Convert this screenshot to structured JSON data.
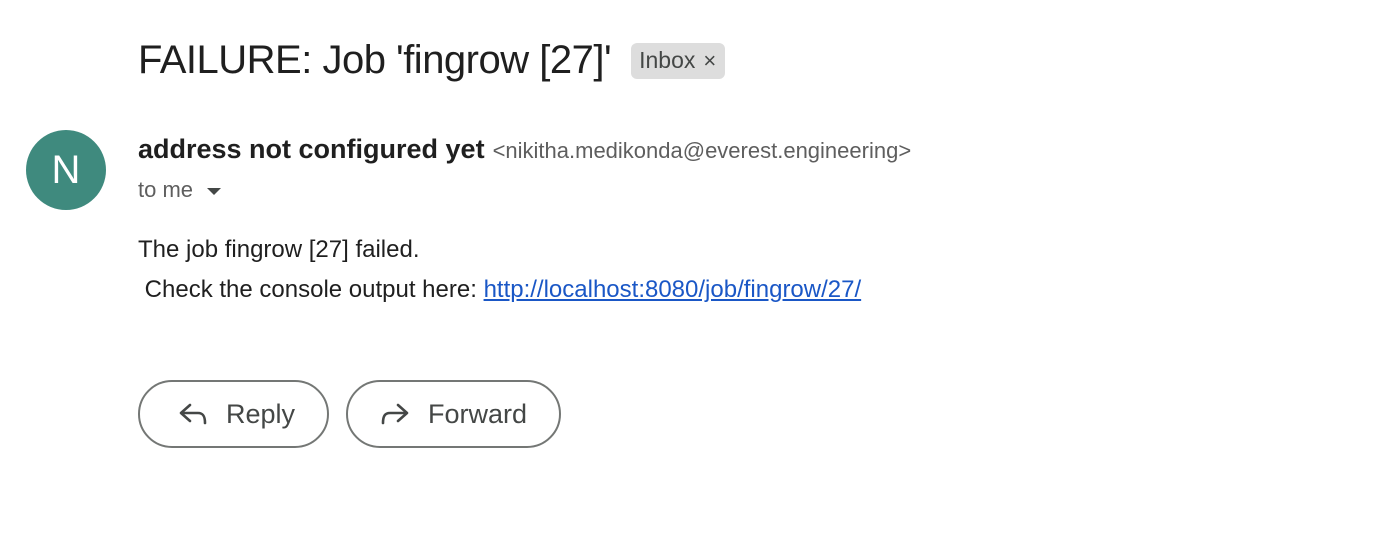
{
  "email": {
    "subject": "FAILURE: Job 'fingrow [27]'",
    "label": "Inbox",
    "label_remove_glyph": "×",
    "sender": {
      "initial": "N",
      "avatar_color": "#3f8a7e",
      "name": "address not configured yet",
      "email": "<nikitha.medikonda@everest.engineering>"
    },
    "recipient_summary": "to me",
    "body": {
      "line1": "The job fingrow [27] failed.",
      "line2_prefix": " Check the console output here: ",
      "link_text": "http://localhost:8080/job/fingrow/27/"
    },
    "actions": {
      "reply_label": "Reply",
      "forward_label": "Forward"
    }
  },
  "icons": {
    "reply": "reply-arrow-icon",
    "forward": "forward-arrow-icon",
    "details": "chevron-down-icon",
    "remove_label": "close-icon"
  },
  "colors": {
    "link": "#1a57c6",
    "chip_bg": "#dddddd",
    "button_border": "#747775"
  }
}
